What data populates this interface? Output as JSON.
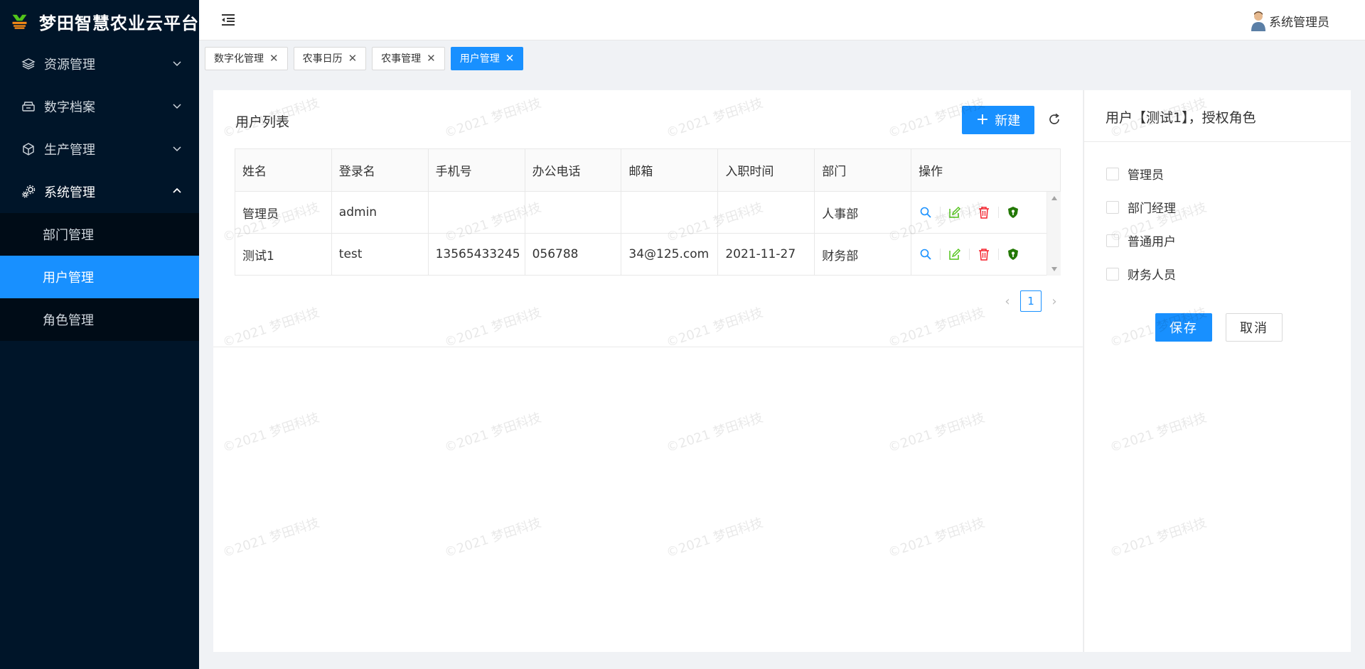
{
  "app": {
    "title": "梦田智慧农业云平台"
  },
  "sidebar": {
    "items": [
      {
        "label": "资源管理",
        "icon": "layers-icon"
      },
      {
        "label": "数字档案",
        "icon": "archive-icon"
      },
      {
        "label": "生产管理",
        "icon": "box-icon"
      },
      {
        "label": "系统管理",
        "icon": "gears-icon"
      }
    ],
    "sub_items": [
      {
        "label": "部门管理"
      },
      {
        "label": "用户管理"
      },
      {
        "label": "角色管理"
      }
    ]
  },
  "header": {
    "user": "系统管理员"
  },
  "tabs": [
    {
      "label": "数字化管理"
    },
    {
      "label": "农事日历"
    },
    {
      "label": "农事管理"
    },
    {
      "label": "用户管理"
    }
  ],
  "user_list": {
    "title": "用户列表",
    "new_button": "新建",
    "columns": [
      "姓名",
      "登录名",
      "手机号",
      "办公电话",
      "邮箱",
      "入职时间",
      "部门",
      "操作"
    ],
    "rows": [
      {
        "name": "管理员",
        "login": "admin",
        "phone": "",
        "office": "",
        "email": "",
        "hired": "",
        "dept": "人事部"
      },
      {
        "name": "测试1",
        "login": "test",
        "phone": "13565433245",
        "office": "056788",
        "email": "34@125.com",
        "hired": "2021-11-27",
        "dept": "财务部"
      }
    ],
    "page": "1"
  },
  "role_panel": {
    "title": "用户【测试1】，授权角色",
    "roles": [
      "管理员",
      "部门经理",
      "普通用户",
      "财务人员"
    ],
    "save": "保存",
    "cancel": "取消"
  },
  "watermark": "©2021 梦田科技",
  "colors": {
    "primary": "#1890ff",
    "sidebar": "#001529",
    "danger": "#f5222d",
    "success": "#52c41a",
    "shield": "#237804"
  }
}
